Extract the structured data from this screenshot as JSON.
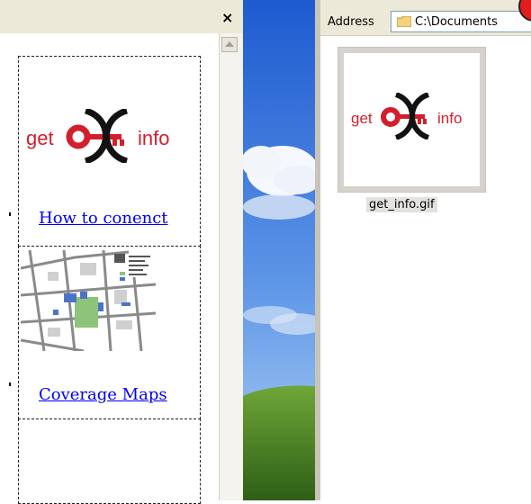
{
  "left_pane": {
    "close_label": "×",
    "cells": [
      {
        "logo": {
          "left": "get",
          "right": "info"
        },
        "link": "How to conenct"
      },
      {
        "thumbnail": "coverage-map",
        "link": "Coverage Maps"
      },
      {
        "empty": true
      }
    ]
  },
  "explorer": {
    "address_label": "Address",
    "address_value": "C:\\Documents",
    "file": {
      "name": "get_info.gif",
      "logo": {
        "left": "get",
        "right": "info"
      }
    }
  },
  "colors": {
    "logo_red": "#d21f2d",
    "logo_black": "#121212",
    "link_blue": "#0000ee",
    "panel_grey": "#ece9d8"
  }
}
